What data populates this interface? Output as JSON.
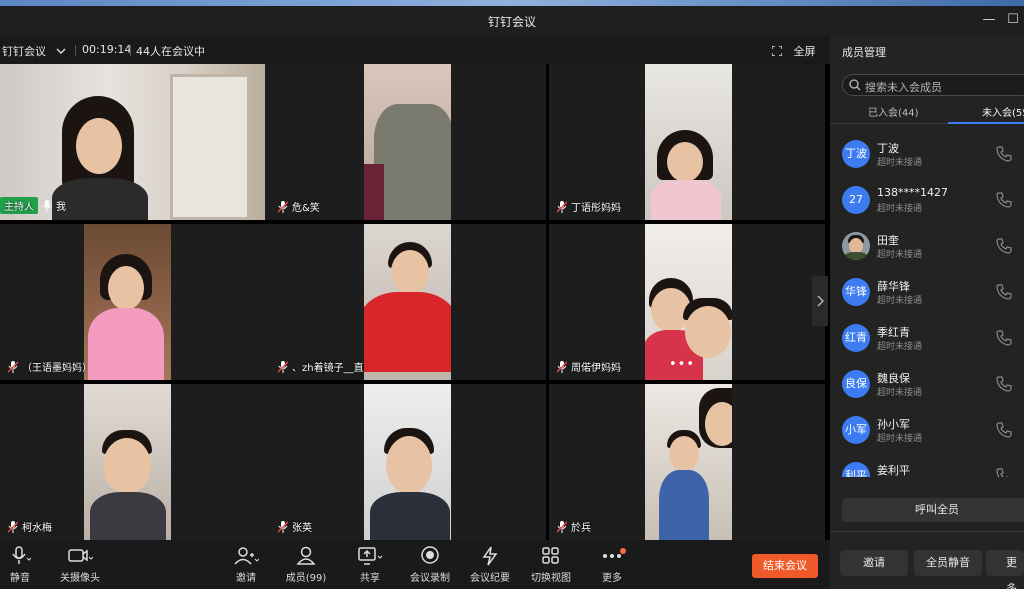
{
  "window": {
    "title": "钉钉会议",
    "minimize": "—",
    "maximize": "☐"
  },
  "infobar": {
    "app_menu": "钉钉会议",
    "duration": "00:19:14",
    "participants": "44人在会议中",
    "fullscreen": "全屏"
  },
  "tiles": [
    {
      "name": "我",
      "host_tag": "主持人"
    },
    {
      "name": "危&笑"
    },
    {
      "name": "丁语彤妈妈"
    },
    {
      "name": "（王语墨妈妈）"
    },
    {
      "name": "、zh着镜子__直"
    },
    {
      "name": "周偌伊妈妈",
      "more": "•••"
    },
    {
      "name": "柯水梅"
    },
    {
      "name": "张英"
    },
    {
      "name": "於兵"
    }
  ],
  "toolbar": {
    "mute": "静音",
    "camera": "关摄像头",
    "invite": "邀请",
    "members": "成员(99)",
    "share": "共享",
    "record": "会议录制",
    "minutes": "会议纪要",
    "switch_view": "切换视图",
    "more": "更多",
    "end_meeting": "结束会议"
  },
  "panel": {
    "title": "成员管理",
    "search_placeholder": "搜索未入会成员",
    "tab_joined": "已入会(44)",
    "tab_not_joined": "未入会(55)",
    "members": [
      {
        "avatar": "丁波",
        "name": "丁波",
        "status": "超时未接通"
      },
      {
        "avatar": "27",
        "name": "138****1427",
        "status": "超时未接通"
      },
      {
        "avatar": "",
        "name": "田奎",
        "status": "超时未接通"
      },
      {
        "avatar": "华锋",
        "name": "薛华锋",
        "status": "超时未接通"
      },
      {
        "avatar": "红青",
        "name": "季红青",
        "status": "超时未接通"
      },
      {
        "avatar": "良保",
        "name": "魏良保",
        "status": "超时未接通"
      },
      {
        "avatar": "小军",
        "name": "孙小军",
        "status": "超时未接通"
      },
      {
        "avatar": "利平",
        "name": "姜利平",
        "status": ""
      }
    ],
    "call_all": "呼叫全员",
    "invite": "邀请",
    "mute_all": "全员静音",
    "more": "更多"
  },
  "colors": {
    "accent": "#3d7cf0",
    "end": "#f05a2a",
    "host": "#21a04a"
  }
}
